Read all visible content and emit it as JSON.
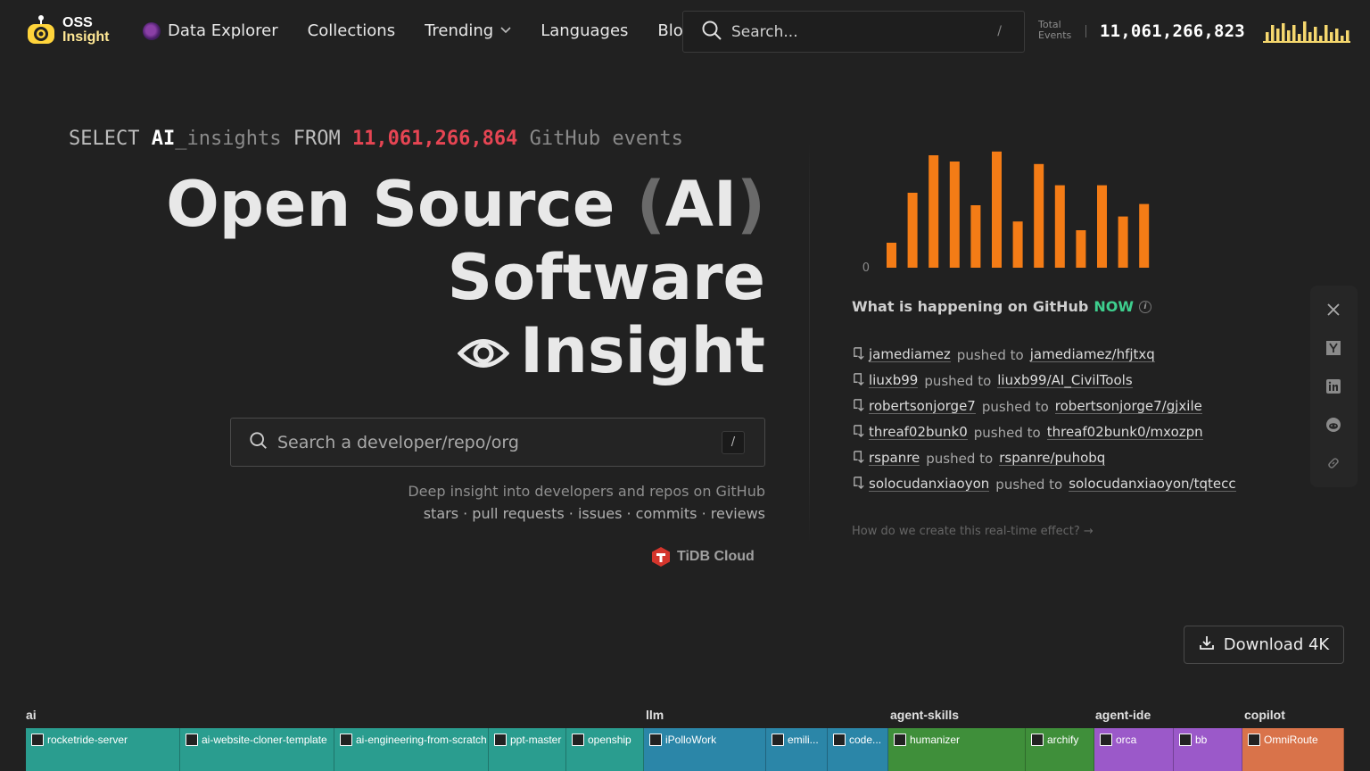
{
  "header": {
    "logo": {
      "line1": "OSS",
      "line2": "Insight"
    },
    "nav": [
      {
        "label": "Data Explorer"
      },
      {
        "label": "Collections"
      },
      {
        "label": "Trending"
      },
      {
        "label": "Languages"
      },
      {
        "label": "Blog"
      }
    ],
    "search": {
      "placeholder": "Search...",
      "shortcut": "/"
    },
    "total_events": {
      "label_line1": "Total",
      "label_line2": "Events",
      "value": "11,061,266,823"
    }
  },
  "hero": {
    "sql_select": "SELECT",
    "sql_ai": "AI",
    "sql_insights": "_insights",
    "sql_from": "FROM",
    "sql_count": "11,061,266,864",
    "sql_tail": "GitHub events",
    "title_open_source": "Open Source",
    "title_paren_open": "(",
    "title_ai": "AI",
    "title_paren_close": ")",
    "title_software": "Software",
    "title_insight": "Insight",
    "search_placeholder": "Search a developer/repo/org",
    "search_shortcut": "/",
    "tagline_line1": "Deep insight into developers and repos on GitHub",
    "tagline_line2": "stars · pull requests · issues · commits · reviews",
    "powered_by": "TiDB Cloud"
  },
  "chart_data": {
    "type": "bar",
    "values": [
      2,
      6,
      9,
      8.5,
      5,
      9.3,
      3.7,
      8.3,
      6.6,
      3,
      6.6,
      4.1,
      5.1
    ],
    "ylim": [
      0,
      10
    ],
    "yticks": [
      "0"
    ],
    "color": "#f47c16"
  },
  "live": {
    "title": "What is happening on GitHub",
    "now": "NOW",
    "info_glyph": "i",
    "connector": "pushed to",
    "events": [
      {
        "user": "jamediamez",
        "repo": "jamediamez/hfjtxq"
      },
      {
        "user": "liuxb99",
        "repo": "liuxb99/AI_CivilTools"
      },
      {
        "user": "robertsonjorge7",
        "repo": "robertsonjorge7/gjxile"
      },
      {
        "user": "threaf02bunk0",
        "repo": "threaf02bunk0/mxozpn"
      },
      {
        "user": "rspanre",
        "repo": "rspanre/puhobq"
      },
      {
        "user": "solocudanxiaoyon",
        "repo": "solocudanxiaoyon/tqtecc"
      }
    ],
    "how_link": "How do we create this real-time effect? →"
  },
  "share": [
    "x-icon",
    "hackernews-icon",
    "linkedin-icon",
    "reddit-icon",
    "link-icon"
  ],
  "download": {
    "label": "Download 4K"
  },
  "treemap": {
    "groups": [
      {
        "label": "ai",
        "color": "#2a9d8f"
      },
      {
        "label": "llm",
        "color": "#2b86a8"
      },
      {
        "label": "agent-skills",
        "color": "#3f8f3a"
      },
      {
        "label": "agent-ide",
        "color": "#9b59c9"
      },
      {
        "label": "copilot",
        "color": "#d9734a"
      }
    ],
    "tiles": [
      {
        "label": "rocketride-server",
        "group": 0
      },
      {
        "label": "ai-website-cloner-template",
        "group": 0
      },
      {
        "label": "ai-engineering-from-scratch",
        "group": 0
      },
      {
        "label": "ppt-master",
        "group": 0
      },
      {
        "label": "openship",
        "group": 0
      },
      {
        "label": "iPolloWork",
        "group": 1
      },
      {
        "label": "emili...",
        "group": 1
      },
      {
        "label": "code...",
        "group": 1
      },
      {
        "label": "humanizer",
        "group": 2
      },
      {
        "label": "archify",
        "group": 2
      },
      {
        "label": "orca",
        "group": 3
      },
      {
        "label": "bb",
        "group": 3
      },
      {
        "label": "OmniRoute",
        "group": 4
      }
    ]
  }
}
